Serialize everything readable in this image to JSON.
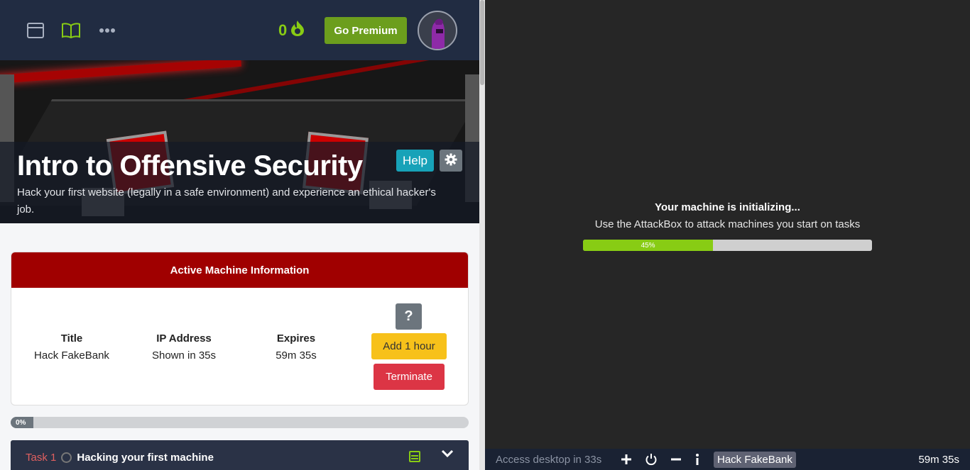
{
  "topbar": {
    "icons": [
      "browser-window-icon",
      "book-icon",
      "more-dots-icon",
      "fire-icon"
    ],
    "streak_count": "0",
    "premium_label": "Go Premium"
  },
  "room": {
    "title": "Intro to Offensive Security",
    "description": "Hack your first website (legally in a safe environment) and experience an ethical hacker's job.",
    "help_label": "Help"
  },
  "machine": {
    "header": "Active Machine Information",
    "title_label": "Title",
    "title_value": "Hack FakeBank",
    "ip_label": "IP Address",
    "ip_value": "Shown in 35s",
    "expires_label": "Expires",
    "expires_value": "59m 35s",
    "help_label": "?",
    "add_label": "Add 1 hour",
    "terminate_label": "Terminate"
  },
  "room_progress": {
    "label": "0%",
    "percent": 0
  },
  "task": {
    "number_label": "Task 1",
    "name": "Hacking your first machine"
  },
  "vm": {
    "status_title": "Your machine is initializing...",
    "status_sub": "Use the AttackBox to attack machines you start on tasks",
    "progress_label": "45%",
    "progress_percent": 45
  },
  "bottombar": {
    "access_text": "Access desktop in 33s",
    "machine_name": "Hack FakeBank",
    "timer": "59m 35s",
    "icons": [
      "plus-icon",
      "power-icon",
      "minus-icon",
      "info-icon"
    ]
  },
  "colors": {
    "topbar": "#212c42",
    "accent_green": "#88cc14",
    "premium_green": "#6c9e1d",
    "card_header_red": "#a00000",
    "help_teal": "#17a2b8",
    "add_yellow": "#f7c11a",
    "terminate_red": "#dc3545",
    "right_bg": "#262626"
  }
}
